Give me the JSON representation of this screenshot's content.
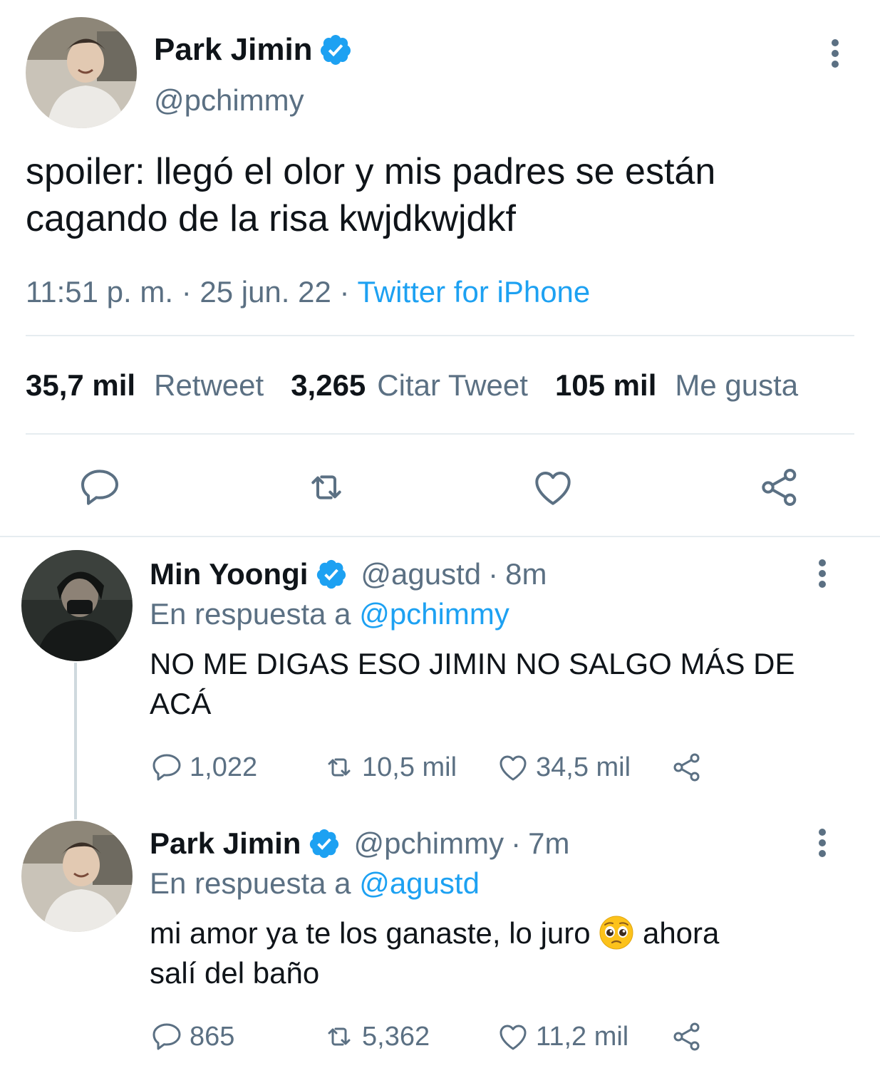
{
  "main_tweet": {
    "author_name": "Park Jimin",
    "author_handle": "@pchimmy",
    "text_line1": "spoiler: llegó el olor y mis padres se están",
    "text_line2": "cagando de la risa kwjdkwjdkf",
    "time": "11:51 p. m.",
    "sep1": "·",
    "date": "25 jun. 22",
    "sep2": "·",
    "source": "Twitter for iPhone",
    "stats": {
      "retweets": "35,7 mil",
      "retweets_label": "Retweet",
      "quotes": "3,265",
      "quotes_label": "Citar Tweet",
      "likes": "105 mil",
      "likes_label": "Me gusta"
    }
  },
  "replies": [
    {
      "author_name": "Min Yoongi",
      "author_handle": "@agustd",
      "sep": "·",
      "age": "8m",
      "reply_prefix": "En respuesta a",
      "reply_to": "@pchimmy",
      "text_line1": "NO ME DIGAS ESO JIMIN NO SALGO MÁS DE",
      "text_line2": "ACÁ",
      "replies": "1,022",
      "retweets": "10,5 mil",
      "likes": "34,5 mil"
    },
    {
      "author_name": "Park Jimin",
      "author_handle": "@pchimmy",
      "sep": "·",
      "age": "7m",
      "reply_prefix": "En respuesta a",
      "reply_to": "@agustd",
      "text_part1": "mi amor ya te los ganaste, lo juro",
      "text_part2": "ahora",
      "text_line2": "salí del baño",
      "emoji": "pleading-face",
      "replies": "865",
      "retweets": "5,362",
      "likes": "11,2 mil"
    }
  ],
  "colors": {
    "accent": "#1da1f2",
    "muted": "#5b7083",
    "text": "#0f1419",
    "divider": "#e6ecf0"
  },
  "icons": [
    "verified-badge-icon",
    "more-icon",
    "reply-icon",
    "retweet-icon",
    "like-icon",
    "share-icon"
  ]
}
